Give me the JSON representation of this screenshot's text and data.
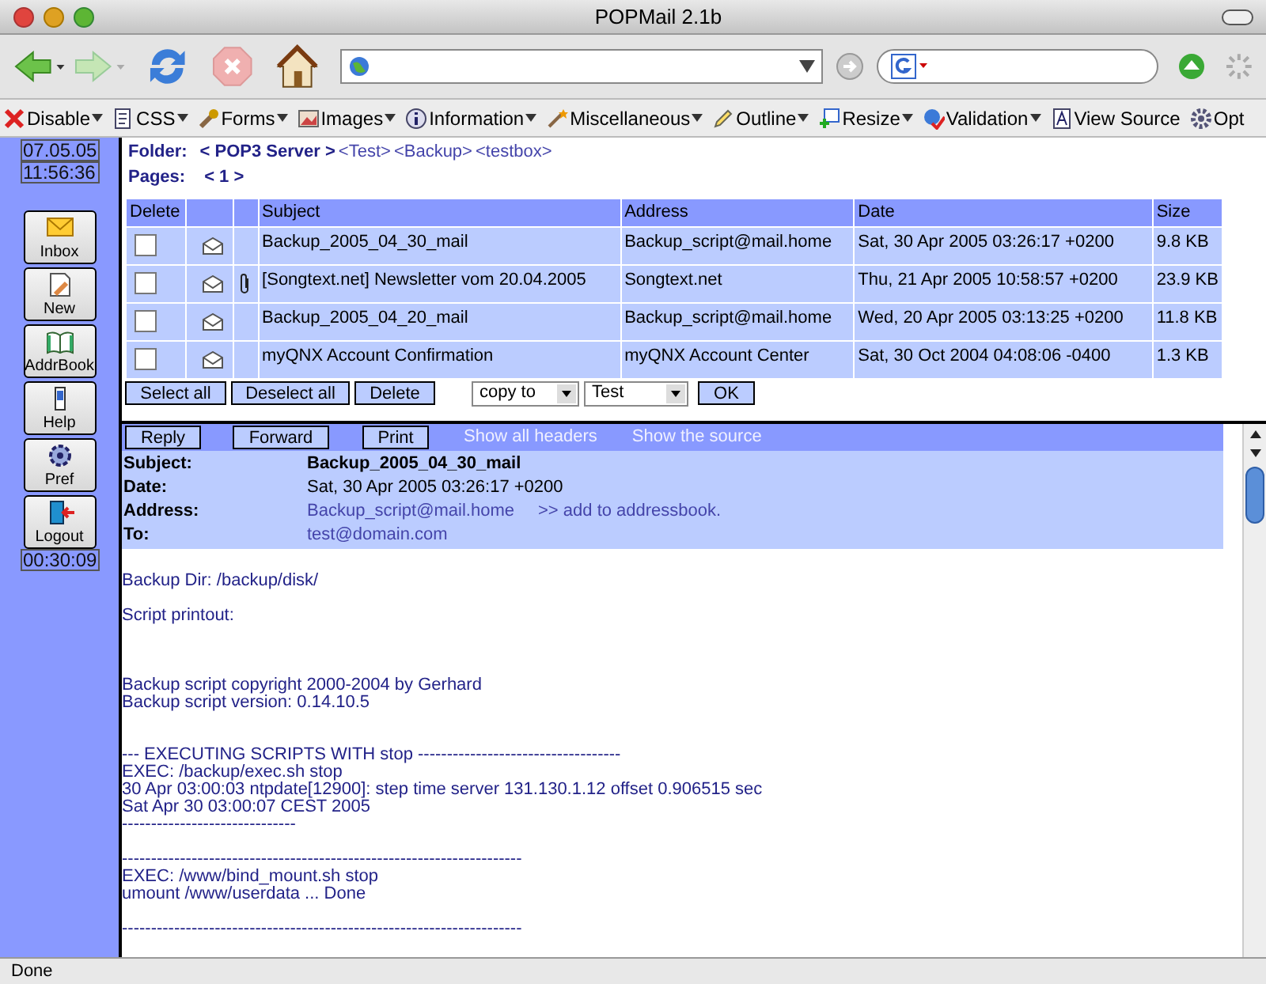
{
  "window": {
    "title": "POPMail 2.1b"
  },
  "dev_toolbar": {
    "items": [
      {
        "label": "Disable",
        "has_menu": true
      },
      {
        "label": "CSS",
        "has_menu": true
      },
      {
        "label": "Forms",
        "has_menu": true
      },
      {
        "label": "Images",
        "has_menu": true
      },
      {
        "label": "Information",
        "has_menu": true
      },
      {
        "label": "Miscellaneous",
        "has_menu": true
      },
      {
        "label": "Outline",
        "has_menu": true
      },
      {
        "label": "Resize",
        "has_menu": true
      },
      {
        "label": "Validation",
        "has_menu": true
      },
      {
        "label": "View Source",
        "has_menu": false
      },
      {
        "label": "Opt",
        "has_menu": false
      }
    ]
  },
  "sidebar": {
    "date": "07.05.05",
    "time": "11:56:36",
    "buttons": [
      {
        "label": "Inbox"
      },
      {
        "label": "New"
      },
      {
        "label": "AddrBook"
      },
      {
        "label": "Help"
      },
      {
        "label": "Pref"
      },
      {
        "label": "Logout"
      }
    ],
    "session_timer": "00:30:09"
  },
  "folder": {
    "label": "Folder:",
    "current": "< POP3 Server >",
    "links": [
      "<Test>",
      "<Backup>",
      "<testbox>"
    ]
  },
  "pages": {
    "label": "Pages:",
    "value": "< 1 >"
  },
  "table": {
    "columns": [
      {
        "kind": "text",
        "label": "Delete"
      },
      {
        "kind": "icon"
      },
      {
        "kind": "icon"
      },
      {
        "kind": "text",
        "label": "Subject"
      },
      {
        "kind": "text",
        "label": "Address"
      },
      {
        "kind": "text",
        "label": "Date"
      },
      {
        "kind": "text",
        "label": "Size"
      }
    ],
    "rows": [
      {
        "checked": false,
        "attachment": false,
        "subject": "Backup_2005_04_30_mail",
        "address": "Backup_script@mail.home",
        "date": "Sat, 30 Apr 2005 03:26:17 +0200",
        "size": "9.8 KB"
      },
      {
        "checked": false,
        "attachment": true,
        "subject": "[Songtext.net] Newsletter vom 20.04.2005",
        "address": "Songtext.net",
        "date": "Thu, 21 Apr 2005 10:58:57 +0200",
        "size": "23.9 KB"
      },
      {
        "checked": false,
        "attachment": false,
        "subject": "Backup_2005_04_20_mail",
        "address": "Backup_script@mail.home",
        "date": "Wed, 20 Apr 2005 03:13:25 +0200",
        "size": "11.8 KB"
      },
      {
        "checked": false,
        "attachment": false,
        "subject": "myQNX Account Confirmation",
        "address": "myQNX Account Center",
        "date": "Sat, 30 Oct 2004 04:08:06 -0400",
        "size": "1.3 KB"
      }
    ]
  },
  "list_actions": {
    "buttons": [
      "Select all",
      "Deselect all",
      "Delete"
    ],
    "selects": [
      "copy to",
      "Test"
    ],
    "ok": "OK"
  },
  "message": {
    "buttons": [
      "Reply",
      "Forward",
      "Print"
    ],
    "links": [
      "Show all headers",
      "Show the source"
    ],
    "headers": [
      {
        "label": "Subject:",
        "value": "Backup_2005_04_30_mail",
        "kind": "bold"
      },
      {
        "label": "Date:",
        "value": "Sat, 30 Apr 2005 03:26:17 +0200",
        "kind": "text"
      },
      {
        "label": "Address:",
        "value": "Backup_script@mail.home",
        "kind": "link",
        "extra": ">> add to addressbook."
      },
      {
        "label": "To:",
        "value": "test@domain.com",
        "kind": "link"
      }
    ],
    "body": [
      {
        "kind": "line",
        "text": "Backup Dir: /backup/disk/"
      },
      {
        "kind": "blank"
      },
      {
        "kind": "line",
        "text": "Script printout:"
      },
      {
        "kind": "blank"
      },
      {
        "kind": "blank"
      },
      {
        "kind": "blank"
      },
      {
        "kind": "line",
        "text": "Backup script copyright 2000-2004 by Gerhard"
      },
      {
        "kind": "line",
        "text": "Backup script version: 0.14.10.5"
      },
      {
        "kind": "blank"
      },
      {
        "kind": "blank"
      },
      {
        "kind": "line",
        "text": "--- EXECUTING SCRIPTS WITH stop -----------------------------------"
      },
      {
        "kind": "line",
        "text": "EXEC: /backup/exec.sh stop"
      },
      {
        "kind": "line",
        "text": "30 Apr 03:00:03 ntpdate[12900]: step time server 131.130.1.12 offset 0.906515 sec"
      },
      {
        "kind": "line",
        "text": "Sat Apr 30 03:00:07 CEST 2005"
      },
      {
        "kind": "line",
        "text": "------------------------------"
      },
      {
        "kind": "blank"
      },
      {
        "kind": "line",
        "text": "---------------------------------------------------------------------"
      },
      {
        "kind": "line",
        "text": "EXEC: /www/bind_mount.sh stop"
      },
      {
        "kind": "line",
        "text": "umount /www/userdata ... Done"
      },
      {
        "kind": "blank"
      },
      {
        "kind": "line",
        "text": "---------------------------------------------------------------------"
      }
    ]
  },
  "status_bar": {
    "text": "Done"
  }
}
